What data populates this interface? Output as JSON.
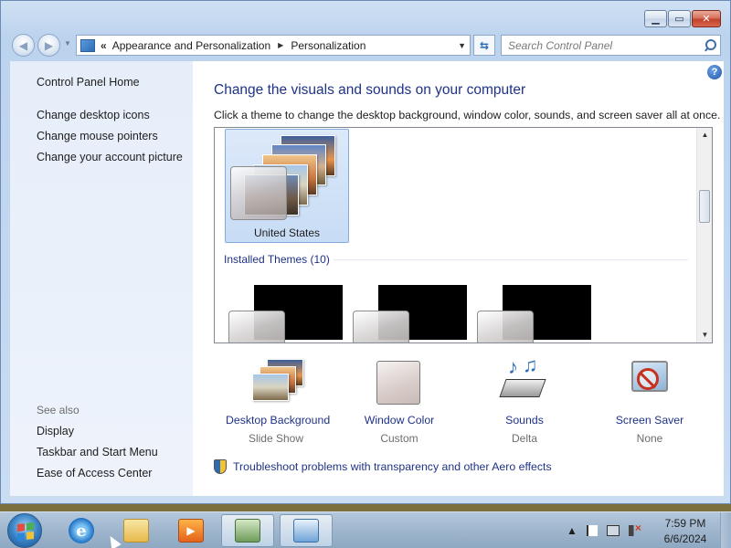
{
  "navigation": {
    "breadcrumbs": [
      "Appearance and Personalization",
      "Personalization"
    ],
    "search_placeholder": "Search Control Panel"
  },
  "left_pane": {
    "home_link": "Control Panel Home",
    "tasks": [
      "Change desktop icons",
      "Change mouse pointers",
      "Change your account picture"
    ],
    "see_also_title": "See also",
    "see_also_links": [
      "Display",
      "Taskbar and Start Menu",
      "Ease of Access Center"
    ]
  },
  "main": {
    "title": "Change the visuals and sounds on your computer",
    "subtitle": "Click a theme to change the desktop background, window color, sounds, and screen saver all at once.",
    "selected_theme_name": "United States",
    "installed_themes_header": "Installed Themes (10)",
    "bottom_items": [
      {
        "label": "Desktop Background",
        "value": "Slide Show"
      },
      {
        "label": "Window Color",
        "value": "Custom"
      },
      {
        "label": "Sounds",
        "value": "Delta"
      },
      {
        "label": "Screen Saver",
        "value": "None"
      }
    ],
    "troubleshoot_link": "Troubleshoot problems with transparency and other Aero effects"
  },
  "taskbar": {
    "time": "7:59 PM",
    "date": "6/6/2024"
  },
  "icons": {
    "help": "help-icon",
    "search": "search-icon",
    "shield": "shield-icon"
  }
}
